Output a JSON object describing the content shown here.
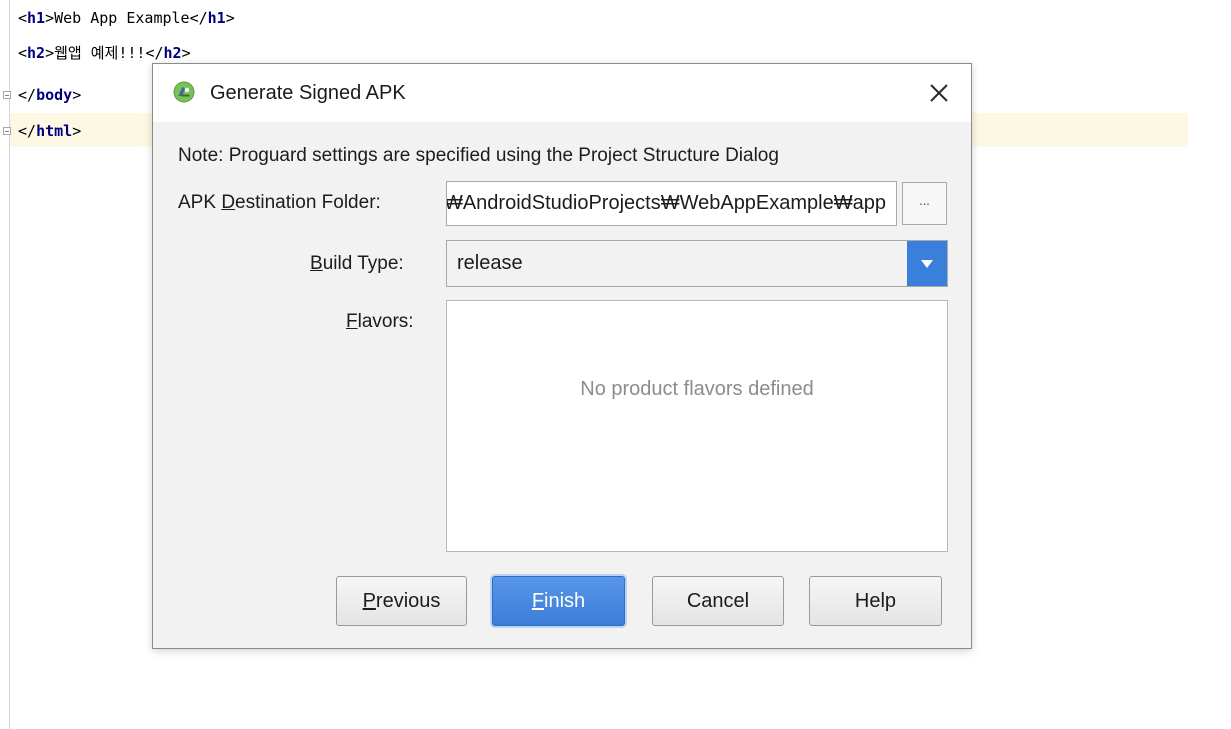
{
  "editor": {
    "lines": [
      {
        "open": "<",
        "tag1": "h1",
        "mid": ">Web App Example</",
        "tag2": "h1",
        "close": ">"
      },
      {
        "open": "<",
        "tag1": "h2",
        "mid": ">웹앱 예제!!!</",
        "tag2": "h2",
        "close": ">"
      },
      {
        "open": "</",
        "tag1": "body",
        "close": ">"
      },
      {
        "open": "</",
        "tag1": "html",
        "close": ">"
      }
    ]
  },
  "dialog": {
    "title": "Generate Signed APK",
    "close_label": "✕",
    "note": "Note: Proguard settings are specified using the Project Structure Dialog",
    "destination_label": {
      "pre": "APK ",
      "mnemonic": "D",
      "post": "estination Folder:"
    },
    "destination_value": "C:₩Users₩User₩AndroidStudioProjects₩WebAppExample₩app",
    "browse_label": "...",
    "build_type_label": {
      "mnemonic": "B",
      "post": "uild Type:"
    },
    "build_type_value": "release",
    "flavors_label": {
      "mnemonic": "F",
      "post": "lavors:"
    },
    "flavors_empty": "No product flavors defined",
    "buttons": {
      "previous": {
        "mnemonic": "P",
        "post": "revious"
      },
      "finish": {
        "mnemonic": "F",
        "post": "inish"
      },
      "cancel": "Cancel",
      "help": "Help"
    }
  },
  "colors": {
    "accent": "#3a7fd9",
    "android_green": "#78c257",
    "caret_row": "#fdf8e3",
    "tag_color": "#000080"
  },
  "icons": {
    "app": "android-studio-icon",
    "close": "close-icon",
    "dropdown": "chevron-down-icon"
  }
}
